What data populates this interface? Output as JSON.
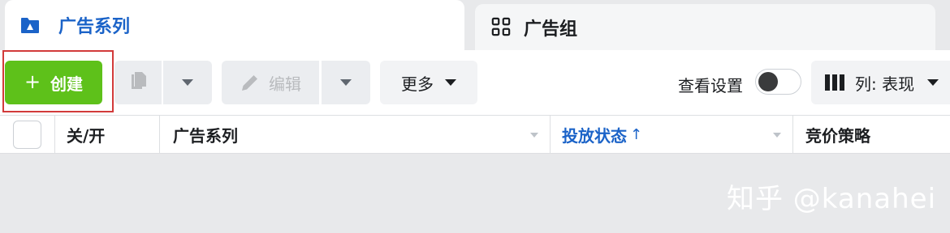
{
  "tabs": [
    {
      "label": "广告系列",
      "icon": "campaign-flag-icon",
      "active": true
    },
    {
      "label": "广告组",
      "icon": "grid-icon",
      "active": false
    }
  ],
  "toolbar": {
    "create_label": "创建",
    "create_plus": "+",
    "edit_label": "编辑",
    "more_label": "更多",
    "view_settings_label": "查看设置",
    "columns_label": "列: 表现",
    "create_color": "#5ec11a",
    "highlight_color": "#d23a3a"
  },
  "table": {
    "columns": [
      "关/开",
      "广告系列",
      "投放状态",
      "竞价策略"
    ],
    "status_sort_indicator": "↑",
    "accent_color": "#1b63c8"
  },
  "watermark": "知乎 @kanahei"
}
